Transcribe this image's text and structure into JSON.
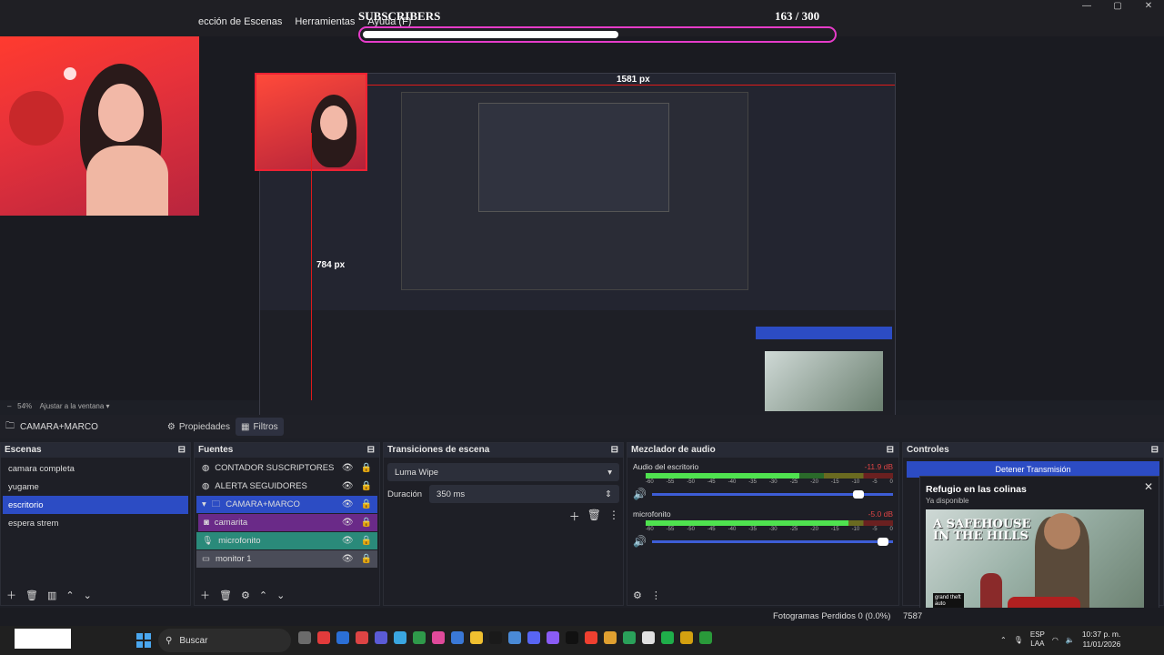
{
  "menu": [
    "ección de Escenas",
    "Herramientas",
    "Ayuda (F)"
  ],
  "window_controls": [
    "—",
    "▢",
    "✕"
  ],
  "subscribers": {
    "title": "SUBSCRIBERS",
    "count": "163  / 300",
    "progress": 0.543
  },
  "measure": {
    "horizontal": "1581 px",
    "vertical": "784 px"
  },
  "zoom": {
    "value": "54%",
    "fit_label": "Ajustar a la ventana"
  },
  "source_bar": {
    "selected": "CAMARA+MARCO",
    "properties": "Propiedades",
    "filters": "Filtros"
  },
  "scenes": {
    "title": "Escenas",
    "items": [
      "camara completa",
      "yugame",
      "escritorio",
      "espera strem"
    ]
  },
  "sources": {
    "title": "Fuentes",
    "items": [
      {
        "label": "CONTADOR SUSCRIPTORES",
        "icon": "globe-icon"
      },
      {
        "label": "ALERTA SEGUIDORES",
        "icon": "globe-icon"
      },
      {
        "label": "CAMARA+MARCO",
        "icon": "folder-icon"
      },
      {
        "label": "camarita",
        "icon": "camera-icon"
      },
      {
        "label": "microfonito",
        "icon": "mic-icon"
      },
      {
        "label": "monitor 1",
        "icon": "monitor-icon"
      }
    ]
  },
  "transitions": {
    "title": "Transiciones de escena",
    "selected": "Luma Wipe",
    "duration_label": "Duración",
    "duration_value": "350 ms"
  },
  "mixer": {
    "title": "Mezclador de audio",
    "channels": [
      {
        "name": "Audio del escritorio",
        "db": "-11.9 dB",
        "level": 0.62,
        "volume": 0.88
      },
      {
        "name": "microfonito",
        "db": "-5.0 dB",
        "level": 0.82,
        "volume": 0.98
      }
    ],
    "ticks": [
      "-60",
      "-55",
      "-50",
      "-45",
      "-40",
      "-35",
      "-30",
      "-25",
      "-20",
      "-15",
      "-10",
      "-5",
      "0"
    ]
  },
  "controls": {
    "title": "Controles",
    "stop_stream": "Detener Transmisión"
  },
  "notification": {
    "title": "Refugio en las colinas",
    "subtitle": "Ya disponible",
    "image_text": "A SAFEHOUSE IN THE HILLS",
    "game_text": "grand theft auto"
  },
  "status": {
    "dropped": "Fotogramas Perdidos 0 (0.0%)",
    "num": "7587"
  },
  "taskbar": {
    "search": "Buscar",
    "lang_top": "ESP",
    "lang_bottom": "LAA",
    "time": "10:37 p. m.",
    "date": "11/01/2026",
    "icon_colors": [
      "#6b6b6b",
      "#e23b3b",
      "#2b6fd6",
      "#d44",
      "#5b5bd6",
      "#3aa6e0",
      "#2f9a4a",
      "#e04a9a",
      "#3a78d6",
      "#f0c030",
      "#1a1a1a",
      "#4a8ad6",
      "#5865f2",
      "#8a5cf6",
      "#111",
      "#f04030",
      "#e0a030",
      "#2aa15a",
      "#e0e0e0",
      "#1fae4a",
      "#d4a010",
      "#2a9a3a"
    ]
  }
}
